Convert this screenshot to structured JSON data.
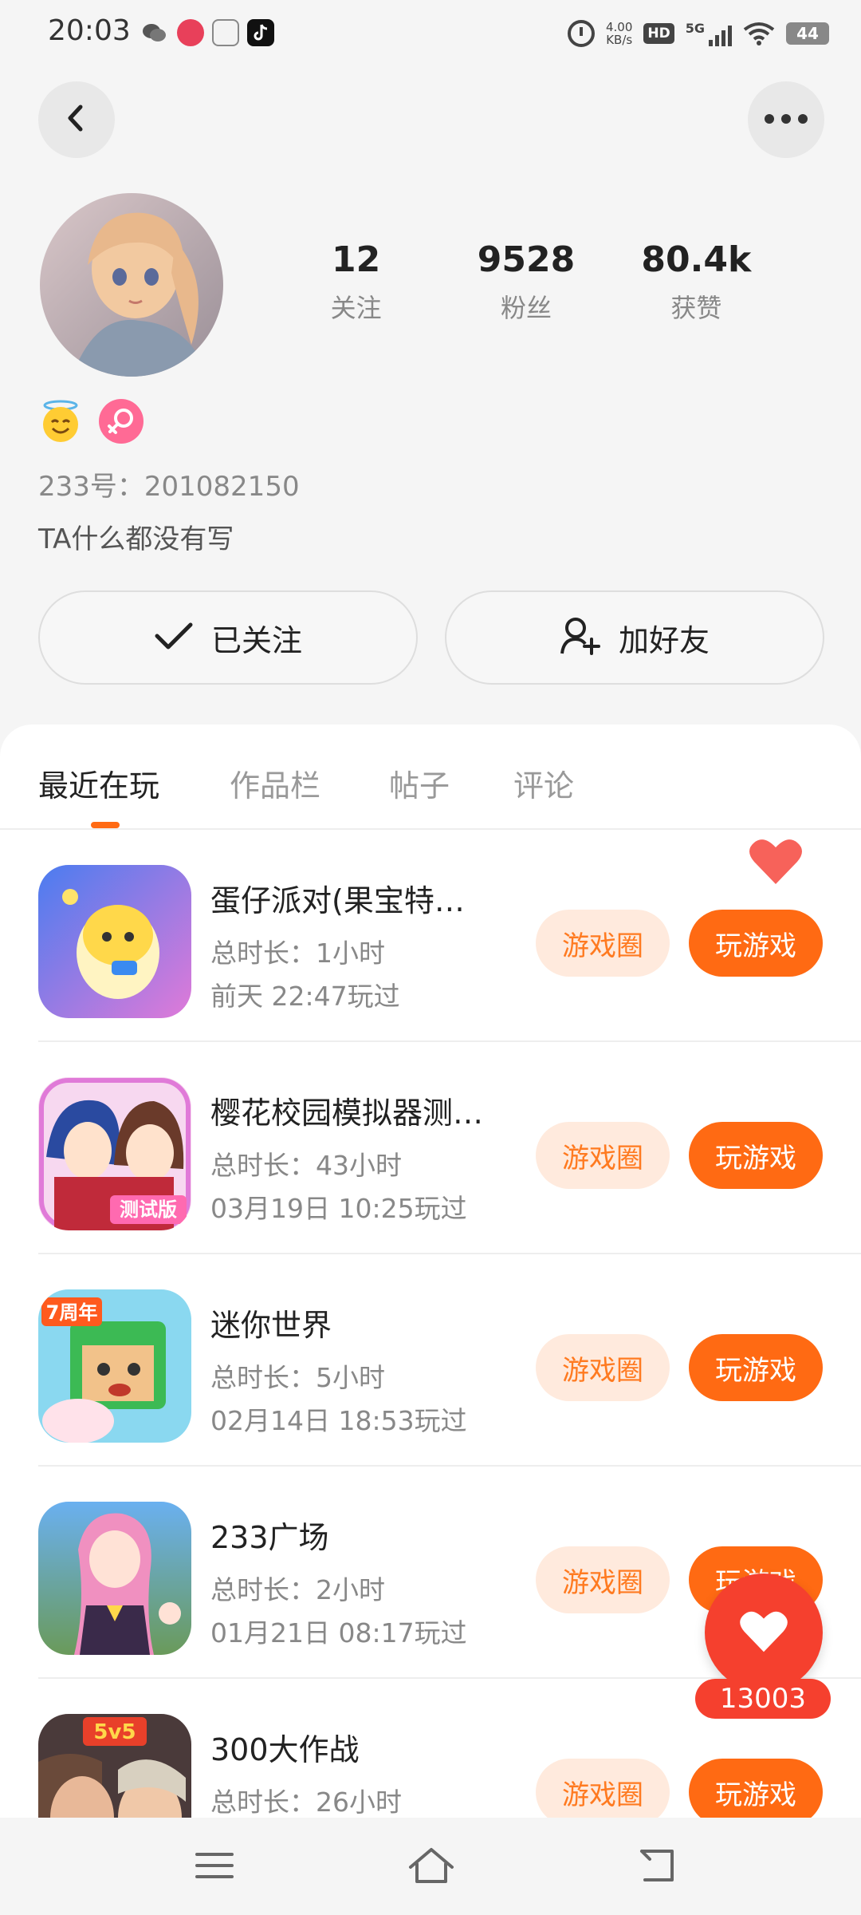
{
  "status_bar": {
    "time": "20:03",
    "net_speed_value": "4.00",
    "net_speed_unit": "KB/s",
    "hd_label": "HD",
    "network_label": "5G",
    "battery": "44"
  },
  "header": {
    "back_icon": "chevron-left-icon",
    "more_icon": "more-dots-icon"
  },
  "profile": {
    "stats": [
      {
        "value": "12",
        "label": "关注"
      },
      {
        "value": "9528",
        "label": "粉丝"
      },
      {
        "value": "80.4k",
        "label": "获赞"
      }
    ],
    "badges": [
      "smiling-halo-emoji",
      "female-icon"
    ],
    "uid": "233号：201082150",
    "bio": "TA什么都没有写",
    "follow_button": "已关注",
    "add_friend_button": "加好友"
  },
  "tabs": [
    "最近在玩",
    "作品栏",
    "帖子",
    "评论"
  ],
  "games": [
    {
      "name": "蛋仔派对(果宝特…",
      "duration": "总时长：1小时",
      "last_played": "前天 22:47玩过"
    },
    {
      "name": "樱花校园模拟器测…",
      "duration": "总时长：43小时",
      "last_played": "03月19日 10:25玩过"
    },
    {
      "name": "迷你世界",
      "duration": "总时长：5小时",
      "last_played": "02月14日 18:53玩过"
    },
    {
      "name": "233广场",
      "duration": "总时长：2小时",
      "last_played": "01月21日 08:17玩过"
    },
    {
      "name": "300大作战",
      "duration": "总时长：26小时",
      "last_played": ""
    }
  ],
  "game_actions": {
    "circle_label": "游戏圈",
    "play_label": "玩游戏"
  },
  "game_icon_badges": {
    "sakura": "测试版",
    "mini_world": "7周年",
    "game300": "5v5"
  },
  "floating_like": {
    "count": "13003",
    "icon": "heart-icon"
  },
  "colors": {
    "accent": "#ff6a13",
    "accent_light": "#ffeadd",
    "like_red": "#f5402e"
  }
}
